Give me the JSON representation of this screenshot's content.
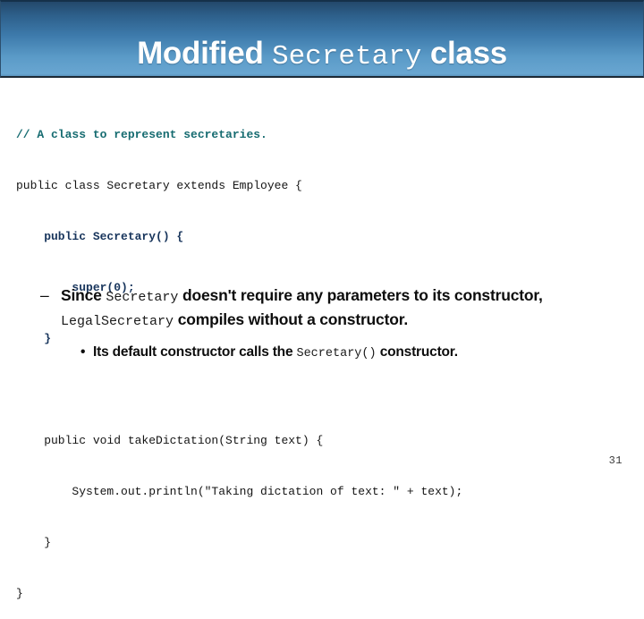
{
  "slide": {
    "title": {
      "part_bold_1": "Modified",
      "part_mono": "Secretary",
      "part_bold_2": "class"
    },
    "code": {
      "lines": [
        "// A class to represent secretaries.",
        "public class Secretary extends Employee {",
        "    public Secretary() {",
        "        super(0);",
        "    }",
        "",
        "    public void takeDictation(String text) {",
        "        System.out.println(\"Taking dictation of text: \" + text);",
        "    }",
        "}"
      ],
      "colors": {
        "comment": "#156b70",
        "plain": "#141414",
        "highlight": "#18355c"
      }
    },
    "bullets": {
      "level2": {
        "marker": "–",
        "seg_1": "Since ",
        "code_1": "Secretary",
        "seg_2": " doesn't require any parameters to its constructor, ",
        "code_2": "LegalSecretary",
        "seg_3": " compiles without a constructor."
      },
      "level3": {
        "marker": "•",
        "seg_1": "Its default constructor calls the ",
        "code_1": "Secretary()",
        "seg_2": " constructor."
      }
    },
    "page_number": "31",
    "theme": {
      "header_gradient_top": "#23486b",
      "header_gradient_bottom": "#69a6d1",
      "header_border": "#1d2a36",
      "title_color": "#ffffff",
      "background": "#ffffff"
    }
  }
}
